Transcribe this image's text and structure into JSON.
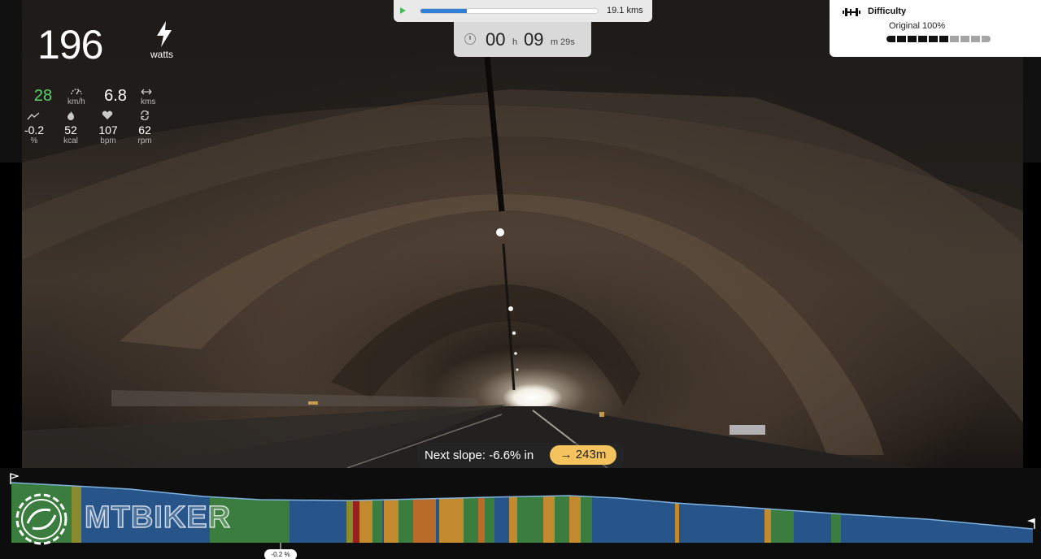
{
  "stats": {
    "power": "196",
    "power_unit": "watts",
    "speed": "28",
    "speed_unit": "km/h",
    "distance": "6.8",
    "distance_unit": "kms",
    "slope": "-0.2",
    "slope_unit": "%",
    "calories": "52",
    "calories_unit": "kcal",
    "heart_rate": "107",
    "heart_rate_unit": "bpm",
    "cadence": "62",
    "cadence_unit": "rpm"
  },
  "route": {
    "progress": 0.26,
    "total_distance": "19.1 kms"
  },
  "timer": {
    "hours": "00",
    "h_label": "h",
    "minutes": "09",
    "m_label": "m",
    "seconds": "29s"
  },
  "difficulty": {
    "title": "Difficulty",
    "subtitle": "Original 100%",
    "level": 6,
    "segments": 10
  },
  "next_slope": {
    "text": "Next slope: -6.6% in",
    "distance": "→ 243m"
  },
  "profile": {
    "current_slope_marker": "-0.2 %",
    "slope_colors": {
      "descent": "#27558a",
      "flat": "#3a7d3e",
      "mild": "#8a8a2e",
      "moderate": "#c28a2c",
      "steep": "#b86a28",
      "very_steep": "#9a2020"
    }
  },
  "branding": {
    "logo_text": "MTBIKER"
  },
  "colors": {
    "accent_green": "#5cd36a",
    "progress_blue": "#2f7fd6",
    "pill_yellow": "#f4c35e"
  }
}
